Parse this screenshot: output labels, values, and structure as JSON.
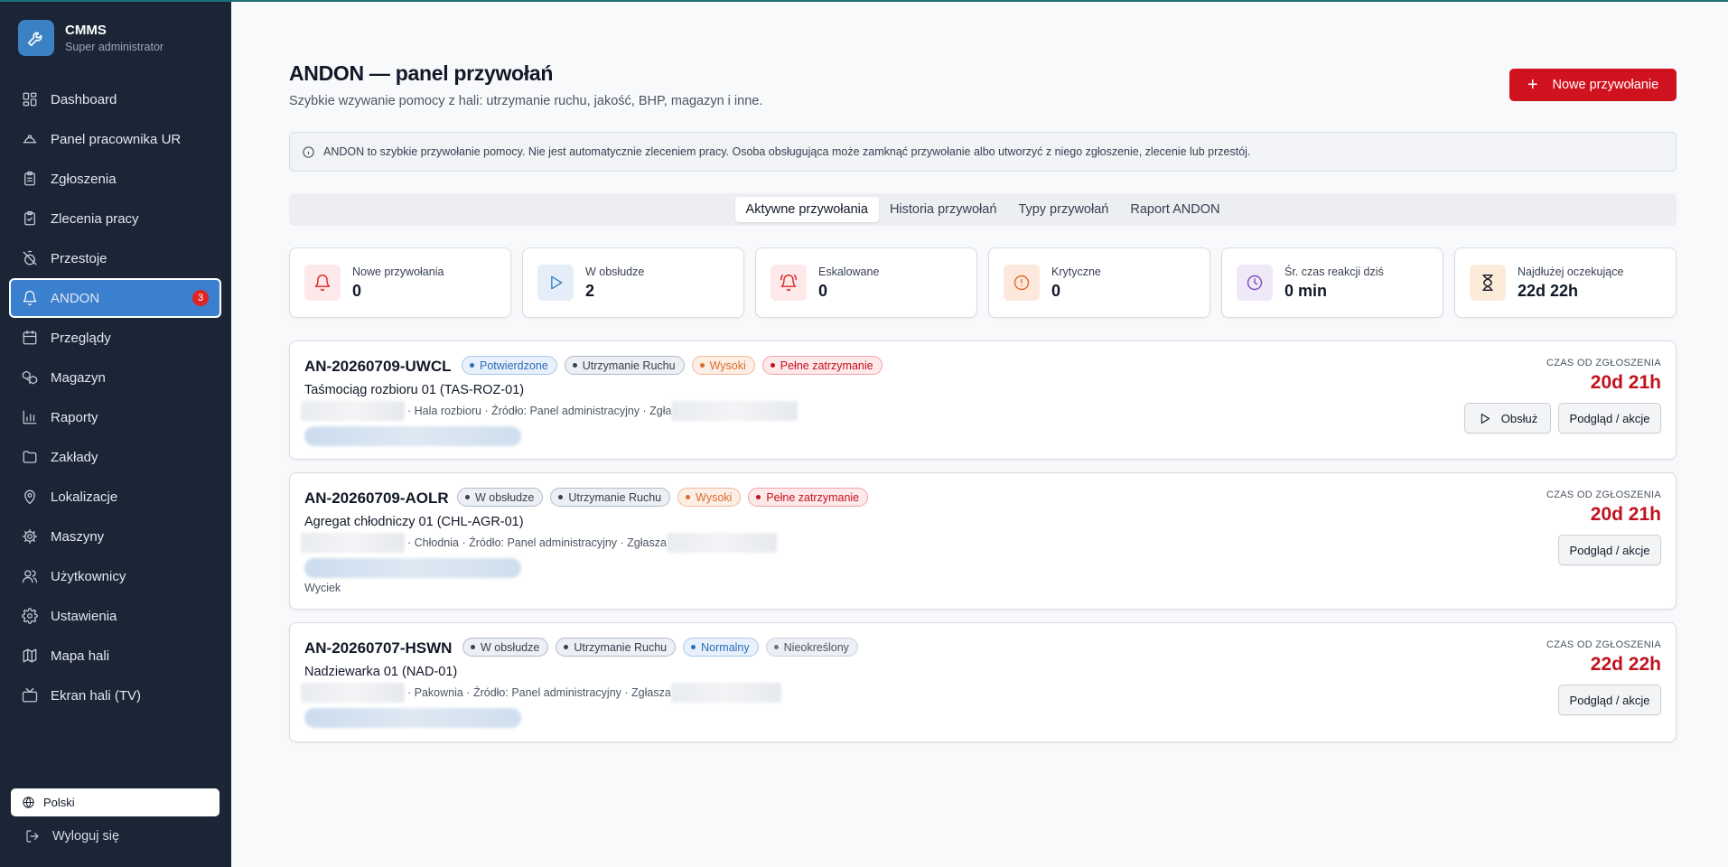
{
  "app": {
    "title": "CMMS",
    "subtitle": "Super administrator"
  },
  "sidebar": {
    "items": [
      {
        "label": "Dashboard",
        "icon": "dashboard-icon"
      },
      {
        "label": "Panel pracownika UR",
        "icon": "helmet-icon"
      },
      {
        "label": "Zgłoszenia",
        "icon": "clipboard-icon"
      },
      {
        "label": "Zlecenia pracy",
        "icon": "clipboard-check-icon"
      },
      {
        "label": "Przestoje",
        "icon": "timer-off-icon"
      },
      {
        "label": "ANDON",
        "icon": "bell-icon",
        "active": true,
        "badge": "3"
      },
      {
        "label": "Przeglądy",
        "icon": "calendar-icon"
      },
      {
        "label": "Magazyn",
        "icon": "boxes-icon"
      },
      {
        "label": "Raporty",
        "icon": "bar-chart-icon"
      },
      {
        "label": "Zakłady",
        "icon": "folder-icon"
      },
      {
        "label": "Lokalizacje",
        "icon": "map-pin-icon"
      },
      {
        "label": "Maszyny",
        "icon": "cog-icon"
      },
      {
        "label": "Użytkownicy",
        "icon": "users-icon"
      },
      {
        "label": "Ustawienia",
        "icon": "settings-icon"
      },
      {
        "label": "Mapa hali",
        "icon": "map-icon"
      },
      {
        "label": "Ekran hali (TV)",
        "icon": "tv-icon"
      }
    ],
    "language": "Polski",
    "logout": "Wyloguj się"
  },
  "header": {
    "title": "ANDON — panel przywołań",
    "subtitle": "Szybkie wzywanie pomocy z hali: utrzymanie ruchu, jakość, BHP, magazyn i inne.",
    "new_button": "Nowe przywołanie"
  },
  "info": "ANDON to szybkie przywołanie pomocy. Nie jest automatycznie zleceniem pracy. Osoba obsługująca może zamknąć przywołanie albo utworzyć z niego zgłoszenie, zlecenie lub przestój.",
  "tabs": [
    {
      "label": "Aktywne przywołania",
      "active": true
    },
    {
      "label": "Historia przywołań"
    },
    {
      "label": "Typy przywołań"
    },
    {
      "label": "Raport ANDON"
    }
  ],
  "stats": [
    {
      "label": "Nowe przywołania",
      "value": "0",
      "icon": "bell-icon",
      "color": "#dc2626",
      "bg": "#fde8ea"
    },
    {
      "label": "W obsłudze",
      "value": "2",
      "icon": "play-icon",
      "color": "#3b82c4",
      "bg": "#e5eef8"
    },
    {
      "label": "Eskalowane",
      "value": "0",
      "icon": "bell-ring-icon",
      "color": "#dc2626",
      "bg": "#fde8ea"
    },
    {
      "label": "Krytyczne",
      "value": "0",
      "icon": "alert-circle-icon",
      "color": "#e0682a",
      "bg": "#fde8dd"
    },
    {
      "label": "Śr. czas reakcji dziś",
      "value": "0 min",
      "icon": "clock-icon",
      "color": "#7c4dbd",
      "bg": "#efe8f7"
    },
    {
      "label": "Najdłużej oczekujące",
      "value": "22d 22h",
      "icon": "hourglass-icon",
      "color": "#111827",
      "bg": "#fdebd9"
    }
  ],
  "calls": [
    {
      "code": "AN-20260709-UWCL",
      "chips": [
        {
          "label": "Potwierdzone",
          "style": "blue"
        },
        {
          "label": "Utrzymanie Ruchu",
          "style": "gray"
        },
        {
          "label": "Wysoki",
          "style": "orange"
        },
        {
          "label": "Pełne zatrzymanie",
          "style": "red"
        }
      ],
      "machine": "Taśmociąg rozbioru 01 (TAS-ROZ-01)",
      "meta": "· Hala rozbioru · Źródło: Panel administracyjny · Zgła",
      "since_label": "CZAS OD ZGŁOSZENIA",
      "since": "20d 21h",
      "handle_button": "Obsłuż",
      "view_button": "Podgląd / akcje"
    },
    {
      "code": "AN-20260709-AOLR",
      "chips": [
        {
          "label": "W obsłudze",
          "style": "gray"
        },
        {
          "label": "Utrzymanie Ruchu",
          "style": "gray"
        },
        {
          "label": "Wysoki",
          "style": "orange"
        },
        {
          "label": "Pełne zatrzymanie",
          "style": "red"
        }
      ],
      "machine": "Agregat chłodniczy 01 (CHL-AGR-01)",
      "meta": "· Chłodnia · Źródło: Panel administracyjny · Zgłasza",
      "note": "Wyciek",
      "since_label": "CZAS OD ZGŁOSZENIA",
      "since": "20d 21h",
      "view_button": "Podgląd / akcje"
    },
    {
      "code": "AN-20260707-HSWN",
      "chips": [
        {
          "label": "W obsłudze",
          "style": "gray"
        },
        {
          "label": "Utrzymanie Ruchu",
          "style": "gray"
        },
        {
          "label": "Normalny",
          "style": "blue"
        },
        {
          "label": "Nieokreślony",
          "style": "plain"
        }
      ],
      "machine": "Nadziewarka 01 (NAD-01)",
      "meta": "· Pakownia · Źródło: Panel administracyjny · Zgłasza",
      "since_label": "CZAS OD ZGŁOSZENIA",
      "since": "22d 22h",
      "view_button": "Podgląd / akcje"
    }
  ]
}
